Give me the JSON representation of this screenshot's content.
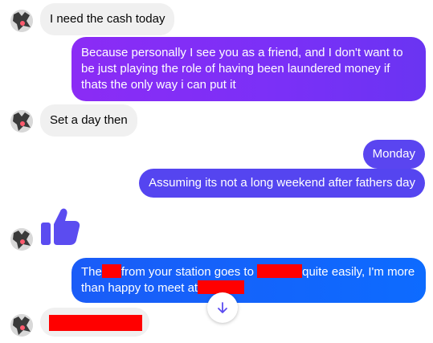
{
  "colors": {
    "incoming_bubble": "#f0f0f0",
    "outgoing_purple": "#7a2cf5",
    "outgoing_indigo": "#5a45f0",
    "outgoing_blue": "#0f62fe",
    "thumbs_up": "#5b4cf0",
    "redaction": "#ff0000"
  },
  "messages": {
    "m1": {
      "text": "I need the cash today"
    },
    "m2": {
      "lines": [
        "Because personally I see you as a friend, and I don't want to",
        "be just playing the role of having been laundered money if",
        "thats the only way i can put it"
      ]
    },
    "m3": {
      "text": "Set a day then"
    },
    "m4": {
      "text": "Monday"
    },
    "m5": {
      "text": "Assuming its not a long weekend after fathers day"
    },
    "m6": {
      "icon": "thumbs-up-icon"
    },
    "m7": {
      "seg1": "The",
      "seg2": "from your station goes to",
      "seg3": "quite easily, I'm more",
      "seg4": "than happy to meet at"
    }
  },
  "icons": {
    "scroll_down": "arrow-down-icon",
    "avatar": "contact-avatar"
  }
}
